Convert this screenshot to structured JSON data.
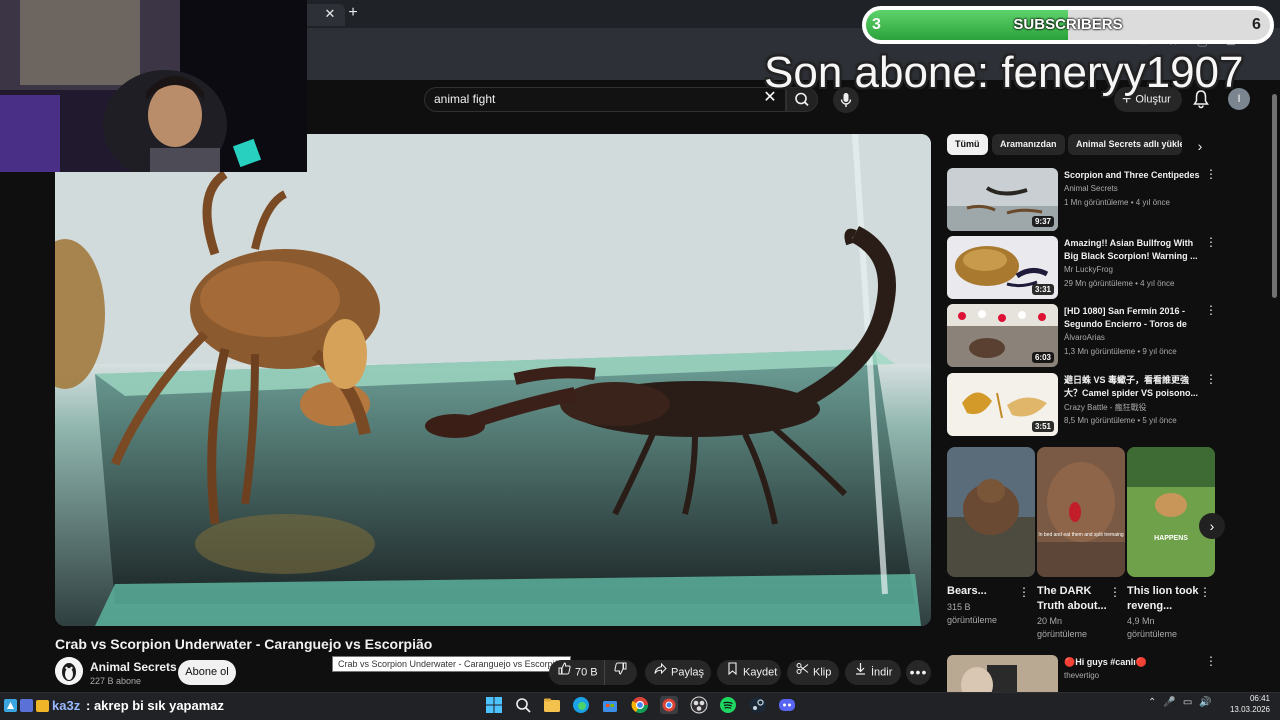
{
  "search": {
    "query": "animal fight"
  },
  "header": {
    "create_label": "Oluştur",
    "profile_initial": "I"
  },
  "overlay": {
    "sub_current": "3",
    "sub_label": "SUBSCRIBERS",
    "sub_goal": "6",
    "sub_progress": 0.5,
    "last_subscriber": "Son abone: feneryy1907"
  },
  "video": {
    "title": "Crab vs Scorpion Underwater - Caranguejo vs Escorpião",
    "tooltip": "Crab vs Scorpion Underwater - Caranguejo vs Escorpião",
    "channel": "Animal Secrets",
    "subscribers": "227 B abone",
    "subscribe_label": "Abone ol",
    "likes": "70 B",
    "share_label": "Paylaş",
    "save_label": "Kaydet",
    "clip_label": "Klip",
    "download_label": "İndir",
    "more_label": "•••"
  },
  "chips": [
    "Tümü",
    "Aramanızdan",
    "Animal Secrets adlı yüklemeler"
  ],
  "recommended": [
    {
      "title": "Scorpion and Three Centipedes",
      "channel": "Animal Secrets",
      "meta": "1 Mn görüntüleme • 4 yıl önce",
      "duration": "9:37"
    },
    {
      "title": "Amazing!! Asian Bullfrog With Big Black Scorpion! Warning ...",
      "channel": "Mr LuckyFrog",
      "meta": "29 Mn görüntüleme • 4 yıl önce",
      "duration": "3:31"
    },
    {
      "title": "[HD 1080] San Fermín 2016 - Segundo Encierro - Toros de la...",
      "channel": "ÁlvaroArias",
      "meta": "1,3 Mn görüntüleme • 9 yıl önce",
      "duration": "6:03"
    },
    {
      "title": "避日蛛 VS 毒蠍子，看看誰更強大？Camel spider VS poisono...",
      "channel": "Crazy Battle - 瘋狂戰役",
      "meta": "8,5 Mn görüntüleme • 5 yıl önce",
      "duration": "3:51"
    }
  ],
  "shorts": [
    {
      "title": "Bears...",
      "views": "315 B",
      "views_label": "görüntüleme"
    },
    {
      "title": "The DARK Truth about...",
      "views": "20 Mn",
      "views_label": "görüntüleme",
      "overlay_text": "In bed and eat them and split tremaing"
    },
    {
      "title": "This lion took reveng...",
      "views": "4,9 Mn",
      "views_label": "görüntüleme",
      "overlay_text": "HAPPENS"
    }
  ],
  "live_rec": {
    "title": "🔴Hi guys  #canlı🔴",
    "channel": "thevertigo"
  },
  "chat": {
    "user": "ka3z",
    "message": ": akrep bi sık yapamaz"
  },
  "clock": {
    "time": "06:41",
    "date": "13.03.2026"
  },
  "colors": {
    "accent": "#ff0000",
    "sub_fill": "#2aa23b",
    "chat_user": "#9ab8ff"
  }
}
